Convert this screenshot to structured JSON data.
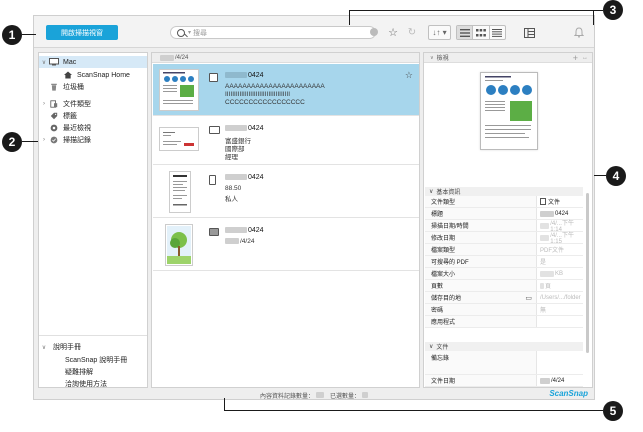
{
  "callouts": [
    "1",
    "2",
    "3",
    "4",
    "5"
  ],
  "toolbar": {
    "scan_label": "開啟掃描視窗",
    "search_placeholder": "搜尋"
  },
  "sidebar": {
    "items": [
      {
        "label": "Mac"
      },
      {
        "label": "ScanSnap Home"
      },
      {
        "label": "垃圾桶"
      },
      {
        "label": "文件類型"
      },
      {
        "label": "標籤"
      },
      {
        "label": "最近檢視"
      },
      {
        "label": "掃描記錄"
      }
    ],
    "help": {
      "title": "說明手冊",
      "items": [
        {
          "label": "ScanSnap 說明手冊"
        },
        {
          "label": "疑難排解"
        },
        {
          "label": "洽詢使用方法"
        }
      ]
    }
  },
  "list": {
    "header": "/4/24",
    "rows": [
      {
        "title": "0424",
        "lines": [
          "AAAAAAAAAAAAAAAAAAAAAAA",
          "IIIIIIIIIIIIIIIIIIIIIIIIIIIIIIIIIIII",
          "CCCCCCCCCCCCCCCCC"
        ]
      },
      {
        "title": "0424",
        "lines": [
          "富盛銀行",
          "國際部",
          "經理"
        ]
      },
      {
        "title": "0424",
        "lines": [
          "88.50",
          "私人"
        ]
      },
      {
        "title": "0424",
        "lines": [
          "/4/24"
        ]
      }
    ]
  },
  "info": {
    "header": "檢視",
    "basic_section": "基本資訊",
    "props": [
      {
        "k": "文件類型",
        "v": "文件"
      },
      {
        "k": "標題",
        "v": "0424"
      },
      {
        "k": "掃描日期/時間",
        "v": "/4/...下午1:14"
      },
      {
        "k": "修改日期",
        "v": "/4/...下午1:15"
      },
      {
        "k": "檔案類型",
        "v": "PDF文件"
      },
      {
        "k": "可搜尋的 PDF",
        "v": "是"
      },
      {
        "k": "檔案大小",
        "v": "KB"
      },
      {
        "k": "頁數",
        "v": "頁"
      },
      {
        "k": "儲存目的地",
        "v": "/Users/.../folder"
      },
      {
        "k": "密碼",
        "v": "無"
      },
      {
        "k": "應用程式",
        "v": ""
      }
    ],
    "doc_section": "文件",
    "doc_props": [
      {
        "k": "備忘錄",
        "v": ""
      },
      {
        "k": "文件日期",
        "v": "/4/24"
      }
    ]
  },
  "status": {
    "text": "內容資料記錄數量：",
    "selected": "已選數量："
  },
  "brand": "ScanSnap",
  "colors": {
    "accent": "#1aa3d9",
    "selection": "#a7d6ec",
    "sidebar_selection": "#d6e9f7"
  }
}
